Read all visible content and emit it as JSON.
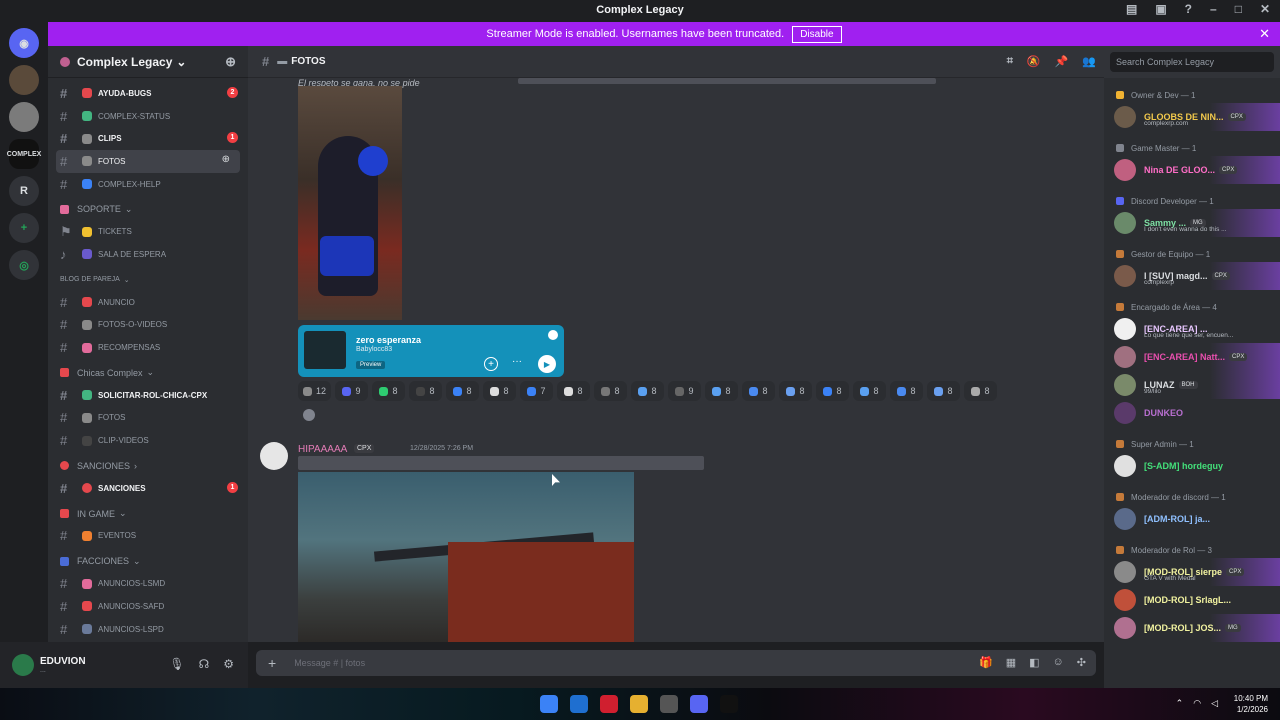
{
  "window": {
    "title": "Complex Legacy"
  },
  "banner": {
    "text": "Streamer Mode is enabled. Usernames have been truncated.",
    "button": "Disable"
  },
  "servers": [
    {
      "label": "",
      "badge": ""
    },
    {
      "label": "",
      "badge": ""
    },
    {
      "label": "COMPLEX",
      "badge": ""
    },
    {
      "label": "R",
      "badge": ""
    },
    {
      "label": "+",
      "badge": ""
    },
    {
      "label": "",
      "badge": ""
    }
  ],
  "guild": {
    "name": "Complex Legacy"
  },
  "channels": [
    {
      "name": "AYUDA-BUGS",
      "bold": true,
      "badge": "2",
      "emoji_color": "#e5484d"
    },
    {
      "name": "COMPLEX-STATUS",
      "bold": false,
      "badge": "",
      "emoji_color": "#43b581"
    },
    {
      "name": "CLIPS",
      "bold": true,
      "badge": "1",
      "emoji_color": "#8a8a8a"
    },
    {
      "name": "FOTOS",
      "bold": false,
      "badge": "",
      "emoji_color": "#8a8a8a",
      "selected": true
    },
    {
      "name": "COMPLEX-HELP",
      "bold": false,
      "badge": "",
      "emoji_color": "#3b82f6"
    }
  ],
  "categories": {
    "soporte": "SOPORTE",
    "blog": "BLOG DE PAREJA",
    "chicas": "Chicas Complex",
    "sanciones": "SANCIONES",
    "ingame": "IN GAME",
    "facciones": "FACCIONES"
  },
  "soporte_channels": [
    "TICKETS",
    "SALA DE ESPERA"
  ],
  "blog_channels": [
    "ANUNCIO",
    "FOTOS-O-VIDEOS",
    "RECOMPENSAS"
  ],
  "chicas_channels": [
    "SOLICITAR-ROL-CHICA-CPX",
    "FOTOS",
    "CLIP-VIDEOS"
  ],
  "sanciones_channels": [
    {
      "name": "SANCIONES",
      "badge": "1"
    }
  ],
  "ingame_channels": [
    "EVENTOS"
  ],
  "facciones_channels": [
    "ANUNCIOS-LSMD",
    "ANUNCIOS-SAFD",
    "ANUNCIOS-LSPD"
  ],
  "user": {
    "name": "EDUVION",
    "status": "..."
  },
  "channel_header": {
    "name": "FOTOS"
  },
  "search": {
    "placeholder": "Search Complex Legacy"
  },
  "chat": {
    "top_message": "El respeto se gana, no se pide",
    "spotify": {
      "title": "zero esperanza",
      "artist": "Babylocc83",
      "preview": "Preview"
    },
    "reactions": [
      "12",
      "9",
      "8",
      "8",
      "8",
      "8",
      "7",
      "8",
      "8",
      "8",
      "9",
      "8",
      "8",
      "8",
      "8",
      "8",
      "8",
      "8",
      "8"
    ],
    "message2": {
      "author": "HIPAAAAA",
      "tag": "CPX",
      "timestamp": "12/28/2025 7:26 PM"
    }
  },
  "composer": {
    "placeholder": "Message # | fotos"
  },
  "members": [
    {
      "role": "Owner & Dev — 1",
      "role_color": "#f0b232",
      "entries": [
        {
          "name": "GLOOBS DE NIN...",
          "sub": "complexrp.com",
          "color": "#f2c94c",
          "tag": "CPX",
          "avatar": "#6b5b4a"
        }
      ]
    },
    {
      "role": "Game Master — 1",
      "role_color": "#80848e",
      "entries": [
        {
          "name": "Nina DE GLOO...",
          "sub": "",
          "color": "#ff6ec7",
          "tag": "CPX",
          "avatar": "#c06080"
        }
      ]
    },
    {
      "role": "Discord Developer — 1",
      "role_color": "#5865f2",
      "entries": [
        {
          "name": "Sammy ...",
          "sub": "I don't even wanna do this ...",
          "color": "#7ee0a4",
          "tag": "MG",
          "avatar": "#6a8a6a"
        }
      ]
    },
    {
      "role": "Gestor de Equipo — 1",
      "role_color": "#c57a3a",
      "entries": [
        {
          "name": "l [SUV] magd...",
          "sub": "complexrp",
          "color": "#dbdee1",
          "tag": "CPX",
          "avatar": "#7a5a4a"
        }
      ]
    },
    {
      "role": "Encargado de Área — 4",
      "role_color": "#c57a3a",
      "entries": [
        {
          "name": "[ENC-AREA] ...",
          "sub": "Lo que tiene que ser, encuen...",
          "color": "#e8c7ff",
          "tag": "",
          "avatar": "#f0f0f0"
        },
        {
          "name": "[ENC-AREA] Natt...",
          "sub": "",
          "color": "#e94fae",
          "tag": "CPX",
          "avatar": "#a07080"
        },
        {
          "name": "LUNAZ",
          "sub": "99/lilo",
          "color": "#dbdee1",
          "tag": "BOH",
          "avatar": "#7a8a6a"
        },
        {
          "name": "DUNKEO",
          "sub": "",
          "color": "#b86fd0",
          "tag": "",
          "avatar": "#5a3a6a"
        }
      ]
    },
    {
      "role": "Super Admin — 1",
      "role_color": "#c57a3a",
      "entries": [
        {
          "name": "[S-ADM] hordeguy",
          "sub": "",
          "color": "#43e07a",
          "tag": "",
          "avatar": "#e0e0e0"
        }
      ]
    },
    {
      "role": "Moderador de discord — 1",
      "role_color": "#c57a3a",
      "entries": [
        {
          "name": "[ADM-ROL] ja...",
          "sub": "",
          "color": "#8fc0ff",
          "tag": "",
          "avatar": "#5a6a8a"
        }
      ]
    },
    {
      "role": "Moderador de Rol — 3",
      "role_color": "#c57a3a",
      "entries": [
        {
          "name": "[MOD-ROL] sierpe",
          "sub": "GTA V with Medal",
          "color": "#f2f3a0",
          "tag": "CPX",
          "avatar": "#8a8a8a"
        },
        {
          "name": "[MOD-ROL] SrlagL...",
          "sub": "",
          "color": "#f2f3a0",
          "tag": "",
          "avatar": "#c0503a"
        },
        {
          "name": "[MOD-ROL] JOS...",
          "sub": "",
          "color": "#f2f3a0",
          "tag": "MG",
          "avatar": "#b07090"
        }
      ]
    }
  ],
  "taskbar": {
    "time": "10:40 PM",
    "date": "1/2/2026"
  }
}
